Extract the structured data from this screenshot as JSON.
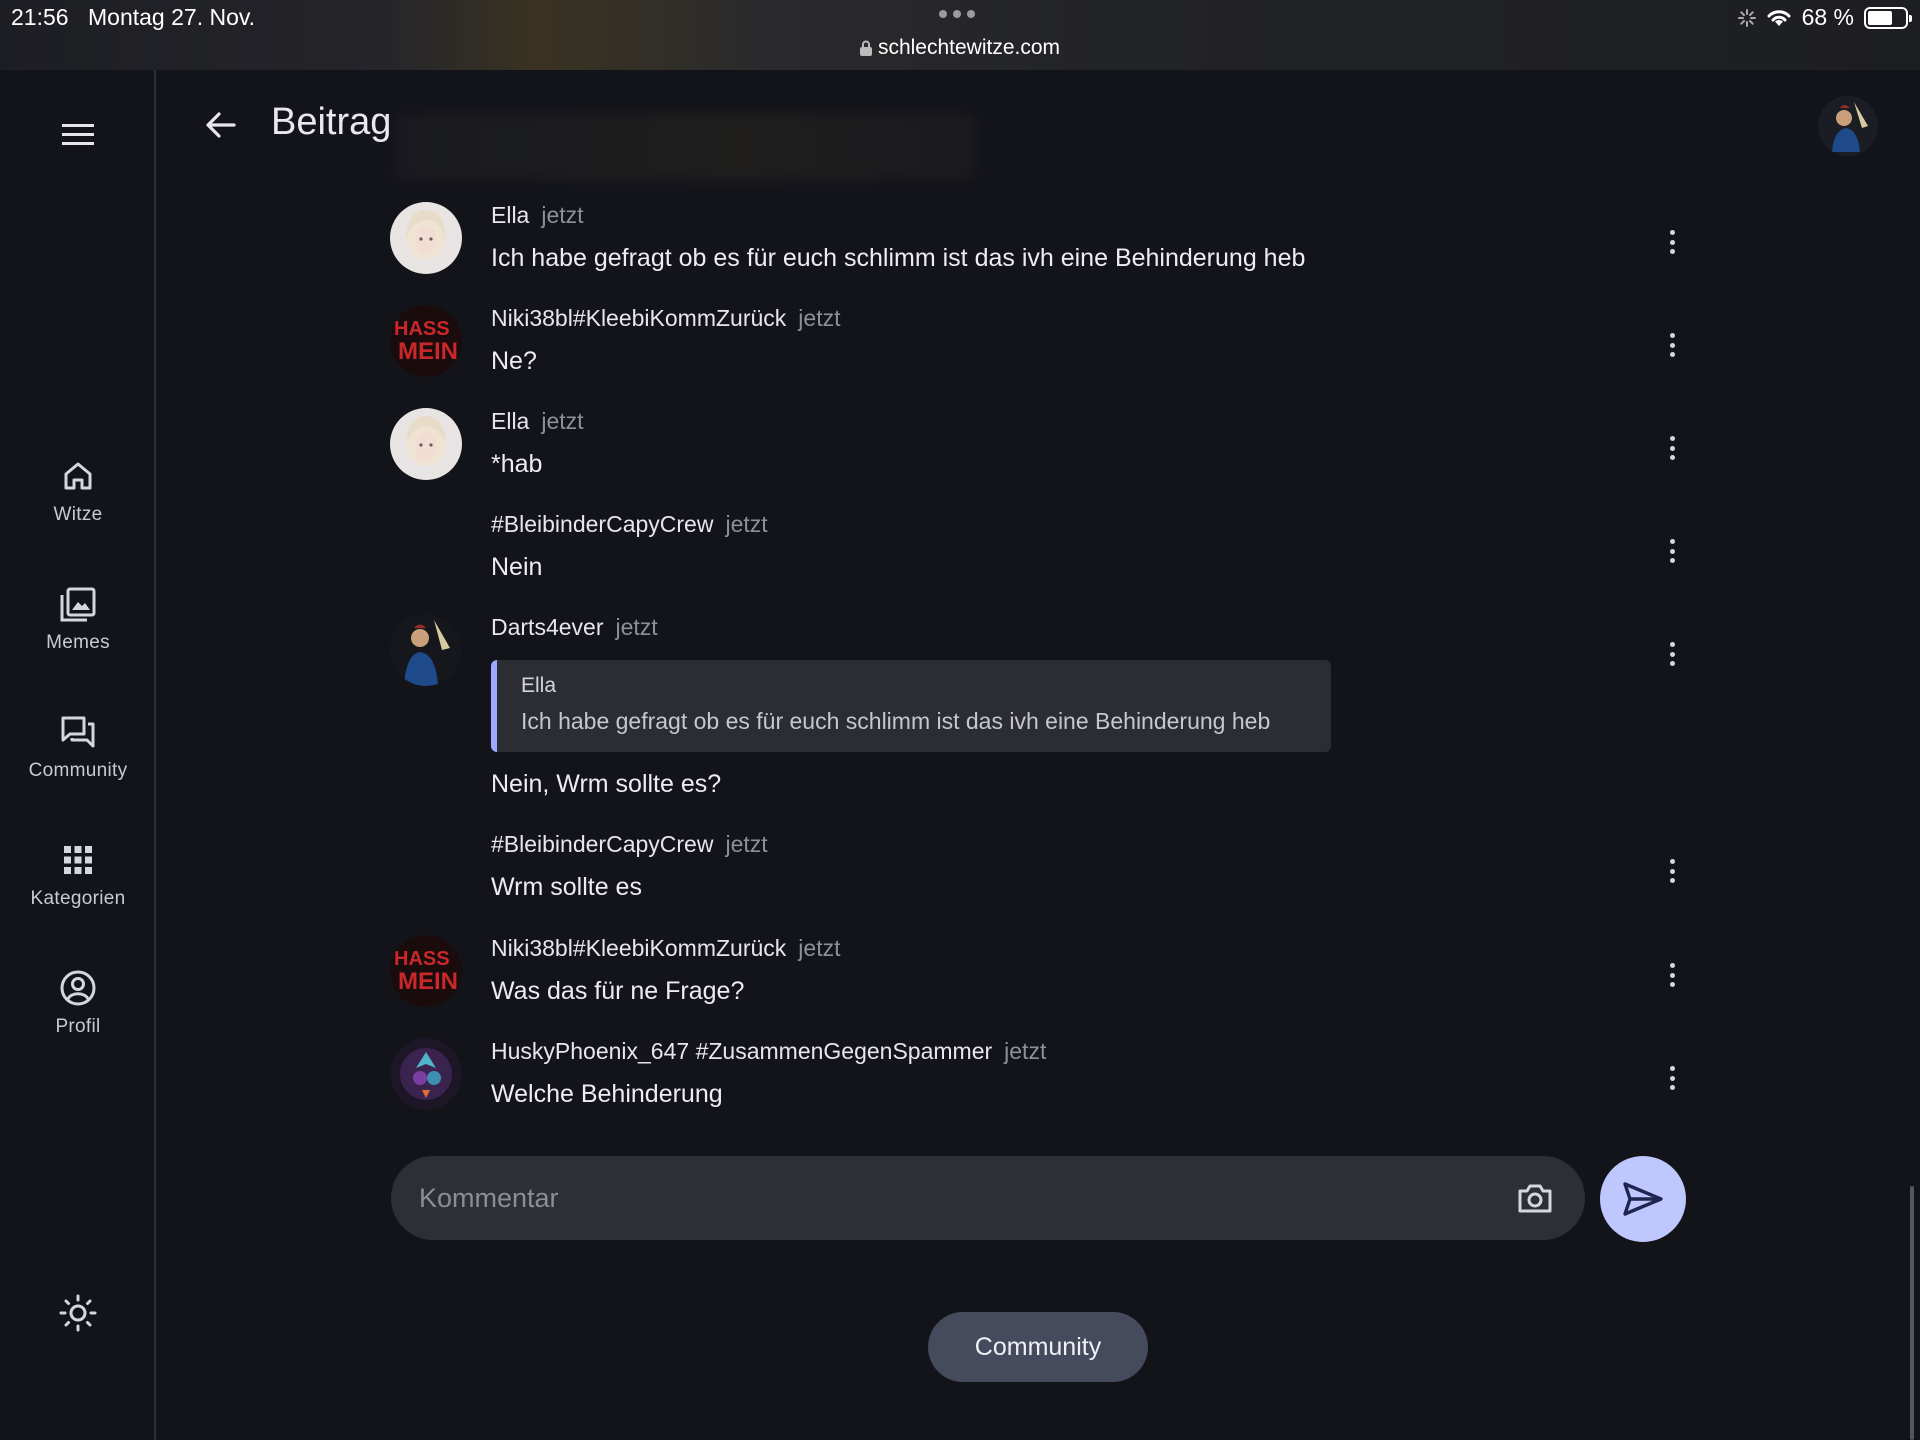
{
  "status_bar": {
    "time": "21:56",
    "date": "Montag 27. Nov.",
    "url": "schlechtewitze.com",
    "battery": "68 %",
    "battery_level": 0.68
  },
  "nav": {
    "items": [
      {
        "label": "Witze",
        "icon": "home-icon"
      },
      {
        "label": "Memes",
        "icon": "images-icon"
      },
      {
        "label": "Community",
        "icon": "chat-icon"
      },
      {
        "label": "Kategorien",
        "icon": "grid-icon"
      },
      {
        "label": "Profil",
        "icon": "account-icon"
      }
    ],
    "theme_icon": "sun-icon"
  },
  "header": {
    "title": "Beitrag"
  },
  "comments": [
    {
      "author": "Ella",
      "time": "jetzt",
      "text": "Ich habe gefragt ob es für euch schlimm ist das ivh eine Behinderung heb",
      "avatar": "ella"
    },
    {
      "author": "Niki38bl#KleebiKommZurück",
      "time": "jetzt",
      "text": "Ne?",
      "avatar": "niki"
    },
    {
      "author": "Ella",
      "time": "jetzt",
      "text": "*hab",
      "avatar": "ella"
    },
    {
      "author": "#BleibinderCapyCrew",
      "time": "jetzt",
      "text": "Nein",
      "avatar": "none"
    },
    {
      "author": "Darts4ever",
      "time": "jetzt",
      "text": "Nein, Wrm sollte es?",
      "avatar": "darts",
      "quote": {
        "author": "Ella",
        "text": "Ich habe gefragt ob es für euch schlimm ist das ivh eine Behinderung heb"
      }
    },
    {
      "author": "#BleibinderCapyCrew",
      "time": "jetzt",
      "text": "Wrm sollte es",
      "avatar": "none"
    },
    {
      "author": "Niki38bl#KleebiKommZurück",
      "time": "jetzt",
      "text": "Was das für ne Frage?",
      "avatar": "niki"
    },
    {
      "author": "HuskyPhoenix_647 #ZusammenGegenSpammer",
      "time": "jetzt",
      "text": "Welche Behinderung",
      "avatar": "husky"
    }
  ],
  "composer": {
    "placeholder": "Kommentar",
    "value": ""
  },
  "footer": {
    "community_label": "Community"
  },
  "colors": {
    "background": "#13141a",
    "accent": "#bfc7ff",
    "quote_bar": "#9fa8ff",
    "chip": "#454a5c"
  }
}
